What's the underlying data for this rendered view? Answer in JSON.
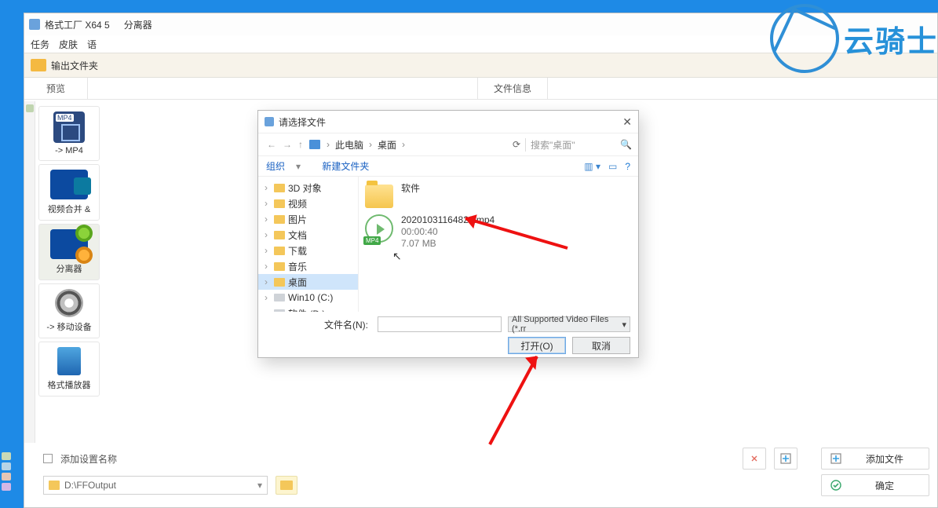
{
  "app": {
    "title_prefix": "格式工厂 X64 5",
    "subtitle": "分离器",
    "menu": [
      "任务",
      "皮肤",
      "语"
    ],
    "toolbar_output": "输出文件夹",
    "tabs": {
      "preview": "预览",
      "fileinfo": "文件信息"
    }
  },
  "tiles": [
    {
      "key": "mp4",
      "label": "-> MP4"
    },
    {
      "key": "merge",
      "label": "视频合并 &"
    },
    {
      "key": "split",
      "label": "分离器"
    },
    {
      "key": "mobile",
      "label": "-> 移动设备"
    },
    {
      "key": "player",
      "label": "格式播放器"
    }
  ],
  "bottom": {
    "add_setting_name": "添加设置名称",
    "add_file": "添加文件",
    "ok": "确定",
    "output_path": "D:\\FFOutput"
  },
  "watermark": "云骑士",
  "dialog": {
    "title": "请选择文件",
    "crumbs": [
      "此电脑",
      "桌面"
    ],
    "search_placeholder": "搜索\"桌面\"",
    "tool_org": "组织",
    "tool_newfolder": "新建文件夹",
    "tree": [
      {
        "label": "3D 对象"
      },
      {
        "label": "视频"
      },
      {
        "label": "图片"
      },
      {
        "label": "文档"
      },
      {
        "label": "下载"
      },
      {
        "label": "音乐"
      },
      {
        "label": "桌面",
        "selected": true
      },
      {
        "label": "Win10 (C:)",
        "drive": true
      },
      {
        "label": "软件 (D:)",
        "drive": true
      }
    ],
    "items": {
      "folder_label": "软件",
      "video": {
        "name": "20201031164822.mp4",
        "duration": "00:00:40",
        "size": "7.07 MB",
        "badge": "MP4"
      }
    },
    "filename_label": "文件名(N):",
    "filetype": "All Supported Video Files (*.rr",
    "open": "打开(O)",
    "cancel": "取消"
  }
}
